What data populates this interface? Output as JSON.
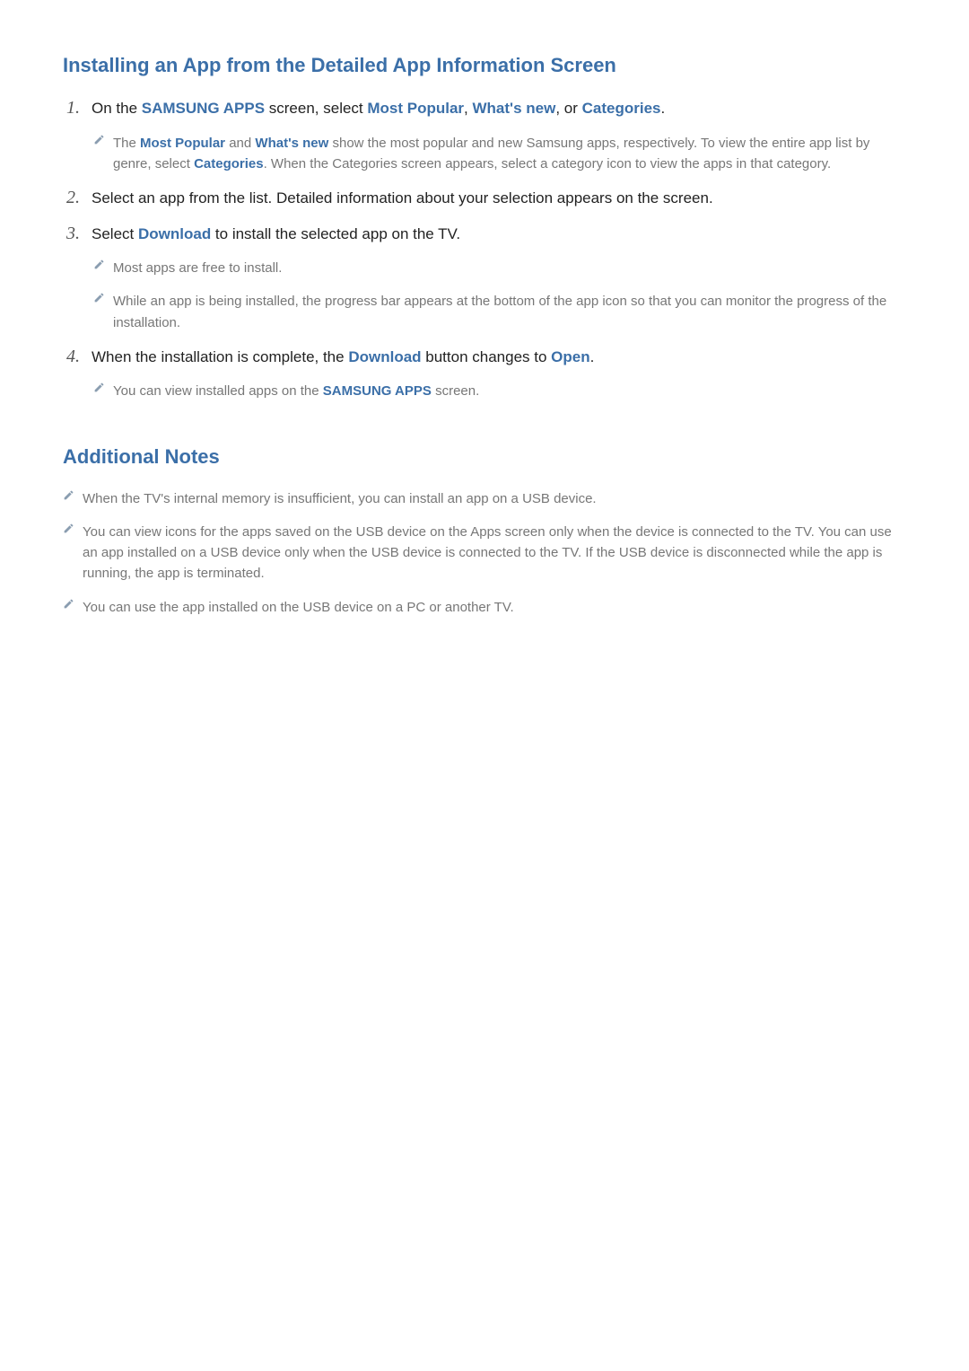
{
  "section1": {
    "heading": "Installing an App from the Detailed App Information Screen",
    "items": [
      {
        "num": "1.",
        "text_parts": {
          "p0": "On the ",
          "l0": "SAMSUNG APPS",
          "p1": " screen, select ",
          "l1": "Most Popular",
          "p2": ", ",
          "l2": "What's new",
          "p3": ", or ",
          "l3": "Categories",
          "p4": "."
        },
        "notes": [
          {
            "p0": "The ",
            "l0": "Most Popular",
            "p1": " and ",
            "l1": "What's new",
            "p2": " show the most popular and new Samsung apps, respectively. To view the entire app list by genre, select ",
            "l2": "Categories",
            "p3": ". When the Categories screen appears, select a category icon to view the apps in that category."
          }
        ]
      },
      {
        "num": "2.",
        "text_parts": {
          "p0": "Select an app from the list. Detailed information about your selection appears on the screen."
        },
        "notes": []
      },
      {
        "num": "3.",
        "text_parts": {
          "p0": "Select ",
          "l0": "Download",
          "p1": " to install the selected app on the TV."
        },
        "notes": [
          {
            "p0": "Most apps are free to install."
          },
          {
            "p0": "While an app is being installed, the progress bar appears at the bottom of the app icon so that you can monitor the progress of the installation."
          }
        ]
      },
      {
        "num": "4.",
        "text_parts": {
          "p0": "When the installation is complete, the ",
          "l0": "Download",
          "p1": " button changes to ",
          "l1": "Open",
          "p2": "."
        },
        "notes": [
          {
            "p0": "You can view installed apps on the ",
            "l0": "SAMSUNG APPS",
            "p1": " screen."
          }
        ]
      }
    ]
  },
  "section2": {
    "heading": "Additional Notes",
    "notes": [
      {
        "p0": "When the TV's internal memory is insufficient, you can install an app on a USB device."
      },
      {
        "p0": "You can view icons for the apps saved on the USB device on the Apps screen only when the device is connected to the TV. You can use an app installed on a USB device only when the USB device is connected to the TV. If the USB device is disconnected while the app is running, the app is terminated."
      },
      {
        "p0": "You can use the app installed on the USB device on a PC or another TV."
      }
    ]
  }
}
